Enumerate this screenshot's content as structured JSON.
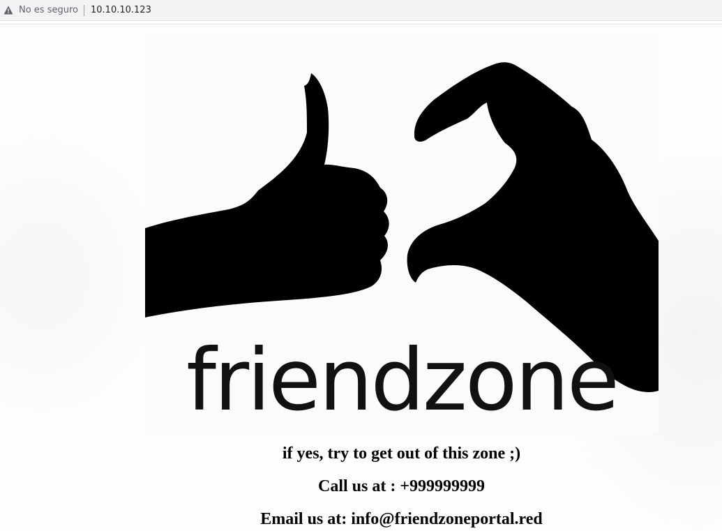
{
  "browser": {
    "security_label": "No es seguro",
    "url": "10.10.10.123",
    "icons": {
      "security": "warning-triangle-icon"
    }
  },
  "hero": {
    "logo_text": "friendzone",
    "icons": [
      "thumbs-up-hand",
      "heart-hand"
    ]
  },
  "content": {
    "line1": "if yes, try to get out of this zone ;)",
    "line2": "Call us at : +999999999",
    "line3": "Email us at: info@friendzoneportal.red"
  }
}
